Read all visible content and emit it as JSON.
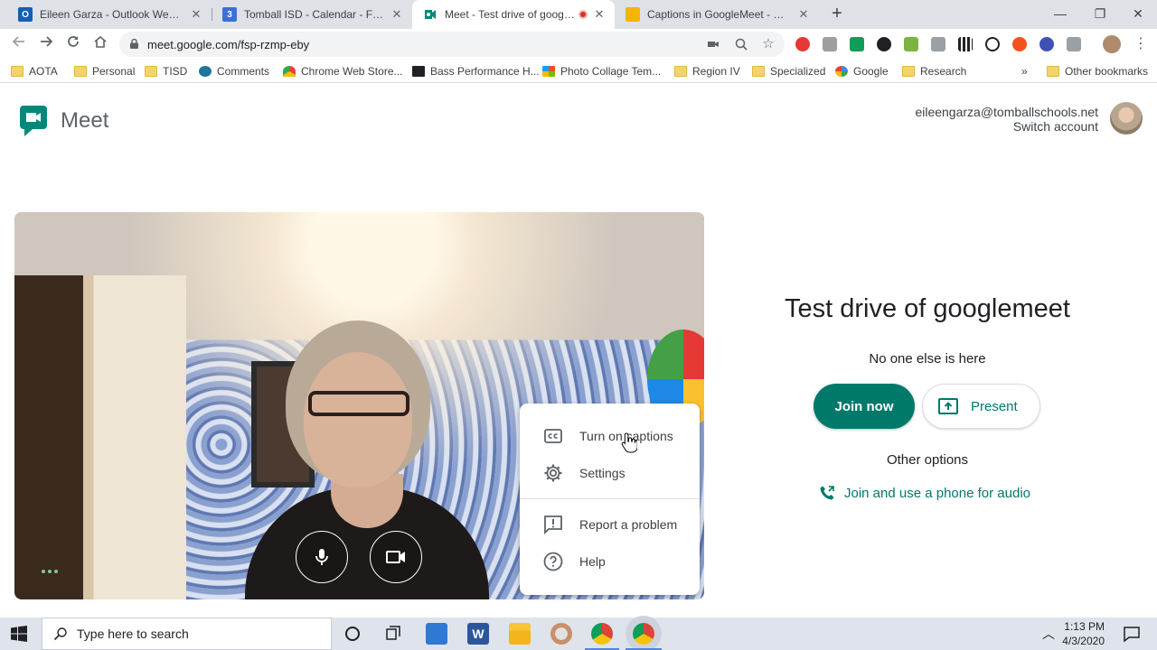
{
  "browser": {
    "tabs": [
      {
        "title": "Eileen Garza - Outlook Web App",
        "active": false
      },
      {
        "title": "Tomball ISD - Calendar - Friday, A",
        "active": false
      },
      {
        "title": "Meet - Test drive of googlemeet",
        "active": true
      },
      {
        "title": "Captions in GoogleMeet - Googl",
        "active": false
      }
    ],
    "calendar_favicon_text": "3",
    "new_tab_label": "+",
    "url": "meet.google.com/fsp-rzmp-eby",
    "bookmarks": [
      "AOTA",
      "Personal",
      "TISD",
      "Comments",
      "Chrome Web Store...",
      "Bass Performance H...",
      "Photo Collage Tem...",
      "Region IV",
      "Specialized",
      "Google",
      "Research"
    ],
    "bookmarks_overflow": "»",
    "other_bookmarks": "Other bookmarks"
  },
  "meet": {
    "logo_text": "Meet",
    "account": {
      "email": "eileengarza@tomballschools.net",
      "switch_label": "Switch account"
    },
    "meeting_title": "Test drive of googlemeet",
    "status": "No one else is here",
    "join_label": "Join now",
    "present_label": "Present",
    "other_options": "Other options",
    "phone_link": "Join and use a phone for audio",
    "menu": [
      {
        "label": "Turn on captions",
        "icon": "captions-icon"
      },
      {
        "label": "Settings",
        "icon": "gear-icon"
      },
      {
        "label": "Report a problem",
        "icon": "feedback-icon"
      },
      {
        "label": "Help",
        "icon": "help-icon"
      }
    ]
  },
  "taskbar": {
    "search_placeholder": "Type here to search",
    "time": "1:13 PM",
    "date": "4/3/2020"
  },
  "colors": {
    "meet_teal": "#00796b",
    "tabstrip": "#dee1e6",
    "taskbar": "#dfe3ec"
  }
}
